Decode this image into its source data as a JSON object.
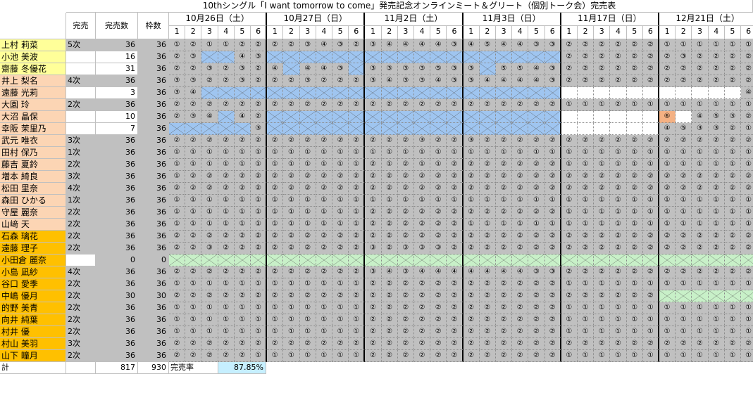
{
  "sheet": {
    "title": "10thシングル「I want tomorrow to come」発売記念オンラインミート＆グリート（個別トーク会）完売表",
    "headers": {
      "kanbai": "完売",
      "kanbai_count": "完売数",
      "wakusu": "枠数"
    },
    "dates": [
      "10月26日（土）",
      "10月27日（日）",
      "11月2日（土）",
      "11月3日（日）",
      "11月17日（日）",
      "12月21日（土）"
    ],
    "parts": [
      "1",
      "2",
      "3",
      "4",
      "5",
      "6"
    ],
    "footer": {
      "label": "計",
      "kanbai_total": "817",
      "waku_total": "930",
      "rate_label": "完売率",
      "rate_value": "87.85%"
    },
    "colors": {
      "yellow": "#ffff99",
      "peach": "#fcd5b4",
      "orange": "#ffc000",
      "gray": "#c0c0c0",
      "blue": "#9fc5f0",
      "green": "#c8f0c8"
    }
  },
  "members": [
    {
      "name": "上村 莉菜",
      "kanbai": "5次",
      "count": "36",
      "waku": "36",
      "color": "yellow",
      "cellbg": "gray",
      "s": "①②①①②②|②②③④③②|③④④④④③|④⑤④④③③|②②②②②②|①①①①①①"
    },
    {
      "name": "小池 美波",
      "kanbai": "",
      "count": "16",
      "waku": "36",
      "color": "yellow",
      "cellbg": "gray",
      "s": "②③XX④③|XXXXXX|XXXXXX|XXXXXX|②②②②②②|②③②②②②"
    },
    {
      "name": "齋藤 冬優花",
      "kanbai": "",
      "count": "31",
      "waku": "36",
      "color": "yellow",
      "cellbg": "gray",
      "s": "②②③②③②|④X④④③X|③③③③⑤③|③X⑤⑤④③|②②②②②②|②②②②②②"
    },
    {
      "name": "井上 梨名",
      "kanbai": "4次",
      "count": "36",
      "waku": "36",
      "color": "peach",
      "cellbg": "gray",
      "s": "③③②②③②|②②③②②②|③④③③④③|③④④④④③|②②②②②②|②②②②②②"
    },
    {
      "name": "遠藤 光莉",
      "kanbai": "",
      "count": "3",
      "waku": "36",
      "color": "peach",
      "cellbg": "gray",
      "s": "③④XXXX|XXXXXX|XXXXXX|XXXXXX|WWWWWW|WWWWW④"
    },
    {
      "name": "大園 玲",
      "kanbai": "2次",
      "count": "36",
      "waku": "36",
      "color": "peach",
      "cellbg": "gray",
      "s": "②②②②②②|②②②②②②|②②②②②②|②②②②②②|①①①②①①|①①①①①①"
    },
    {
      "name": "大沼 晶保",
      "kanbai": "",
      "count": "10",
      "waku": "36",
      "color": "peach",
      "cellbg": "gray",
      "s": "②③④X④②|XXXXXX|XXXXXX|XXXXXX|WWWWWW|⑥W④⑤③②"
    },
    {
      "name": "幸阪 茉里乃",
      "kanbai": "",
      "count": "7",
      "waku": "36",
      "color": "peach",
      "cellbg": "gray",
      "s": "XXXXX③|XXXXXX|XXXXXX|XXXXXX|WWWWWW|④⑤③③②①"
    },
    {
      "name": "武元 唯衣",
      "kanbai": "3次",
      "count": "36",
      "waku": "36",
      "color": "peach",
      "cellbg": "gray",
      "s": "②②②②②②|②②②②②②|②②②③②②|③②②②②②|②②②②②②|②②②②②②"
    },
    {
      "name": "田村 保乃",
      "kanbai": "1次",
      "count": "36",
      "waku": "36",
      "color": "peach",
      "cellbg": "gray",
      "s": "①①①①①①|①①①①①①|①①①①①①|①①①①①①|①①①①①①|①①①①①①"
    },
    {
      "name": "藤吉 夏鈴",
      "kanbai": "2次",
      "count": "36",
      "waku": "36",
      "color": "peach",
      "cellbg": "gray",
      "s": "①①①①①①|①①①①①①|②①②①①②|②②②②②②|①①①①①①|①①①①①①"
    },
    {
      "name": "増本 綺良",
      "kanbai": "3次",
      "count": "36",
      "waku": "36",
      "color": "peach",
      "cellbg": "gray",
      "s": "①②②②②②|②②②②②②|②②②②②②|②②②②②②|②②②②②②|②②②②②②"
    },
    {
      "name": "松田 里奈",
      "kanbai": "4次",
      "count": "36",
      "waku": "36",
      "color": "peach",
      "cellbg": "gray",
      "s": "②②②②②②|②②②②②②|②②②②②②|②②②②②②|②②②②②②|②②②②②②"
    },
    {
      "name": "森田 ひかる",
      "kanbai": "1次",
      "count": "36",
      "waku": "36",
      "color": "peach",
      "cellbg": "gray",
      "s": "①①①①①①|①①①①①①|①①①①①①|①①①①①①|①①①①①①|①①①①①①"
    },
    {
      "name": "守屋 麗奈",
      "kanbai": "2次",
      "count": "36",
      "waku": "36",
      "color": "peach",
      "cellbg": "gray",
      "s": "①①①①①①|①①①①①①|②②②②②②|②②②②②②|①①①①①①|①①①①①①"
    },
    {
      "name": "山﨑 天",
      "kanbai": "2次",
      "count": "36",
      "waku": "36",
      "color": "peach",
      "cellbg": "gray",
      "s": "①①①①①①|①①①①①①|②②②②②②|①①①①①①|①①①①①①|①①①①①①"
    },
    {
      "name": "石森 璃花",
      "kanbai": "2次",
      "count": "36",
      "waku": "36",
      "color": "orange",
      "cellbg": "gray",
      "s": "②②②②②②|②②②②②②|②②②②②②|②②②②②②|②②②②②②|②②②②②②"
    },
    {
      "name": "遠藤 理子",
      "kanbai": "2次",
      "count": "36",
      "waku": "36",
      "color": "orange",
      "cellbg": "gray",
      "s": "②②③②②②|②②②②②②|③②③③③②|②②②②②②|②②②②②②|②②②②②②"
    },
    {
      "name": "小田倉 麗奈",
      "kanbai": "",
      "count": "0",
      "waku": "0",
      "color": "orange",
      "cellbg": "gray",
      "s": "GGGGGG|GGGGGG|GGGGGG|GGGGGG|GGGGGG|GGGGGG"
    },
    {
      "name": "小島 凪紗",
      "kanbai": "4次",
      "count": "36",
      "waku": "36",
      "color": "orange",
      "cellbg": "gray",
      "s": "②②②②②②|②②②②②②|③④③④④④|④④④④③③|②②②②②②|②②②②②②"
    },
    {
      "name": "谷口 愛季",
      "kanbai": "2次",
      "count": "36",
      "waku": "36",
      "color": "orange",
      "cellbg": "gray",
      "s": "①①①①①①|①①①①①①|②②②②②②|②②②②②②|①①①①①①|①①①①①①"
    },
    {
      "name": "中嶋 優月",
      "kanbai": "2次",
      "count": "30",
      "waku": "30",
      "color": "orange",
      "cellbg": "gray",
      "s": "②②②②②②|②②②②②②|②②②②②②|②②②②②②|②②②②②②|GGGGGG"
    },
    {
      "name": "的野 美青",
      "kanbai": "2次",
      "count": "36",
      "waku": "36",
      "color": "orange",
      "cellbg": "gray",
      "s": "①①①①①①|①①①①①①|②②②②②②|②②②②②②|①①①①①①|①①①①①①"
    },
    {
      "name": "向井 純葉",
      "kanbai": "2次",
      "count": "36",
      "waku": "36",
      "color": "orange",
      "cellbg": "gray",
      "s": "①①①①①①|①①①①①①|②②②②②②|②②②②②②|①①①①①①|①①①①①①"
    },
    {
      "name": "村井 優",
      "kanbai": "2次",
      "count": "36",
      "waku": "36",
      "color": "orange",
      "cellbg": "gray",
      "s": "①①①①①①|①①①①①①|②②②②②②|②②②②②②|①①①①①①|①①①①①①"
    },
    {
      "name": "村山 美羽",
      "kanbai": "3次",
      "count": "36",
      "waku": "36",
      "color": "orange",
      "cellbg": "gray",
      "s": "②②②②②②|②②②②②②|②②②②②②|②②②②②②|②②②②②②|②②②②②②"
    },
    {
      "name": "山下 瞳月",
      "kanbai": "2次",
      "count": "36",
      "waku": "36",
      "color": "orange",
      "cellbg": "gray",
      "s": "②②②②②①|①①①①①①|②②②②②②|②②②②②②|①①①①①①|①①①①①①"
    }
  ]
}
